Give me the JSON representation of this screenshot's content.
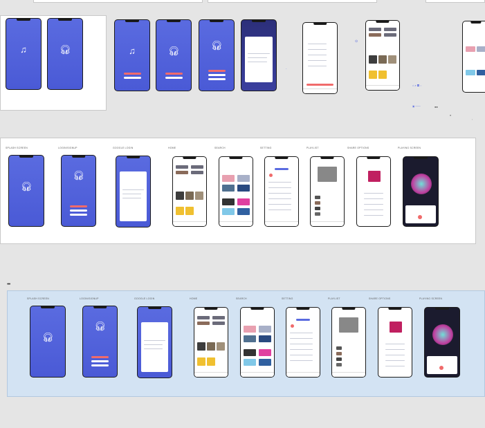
{
  "canvas": {
    "row2_labels": [
      "SPLASH SCREEN",
      "LOGIN/SIGNUP",
      "GOOGLE LOGIN",
      "HOME",
      "SEARCH",
      "SETTING",
      "PLAYLIST",
      "SHARE OPTIONS",
      "PLAYING SCREEN"
    ],
    "row3_labels": [
      "SPLASH SCREEN",
      "LOGIN/SIGNUP",
      "GOOGLE LOGIN",
      "HOME",
      "SEARCH",
      "SETTING",
      "PLAYLIST",
      "SHARE OPTIONS",
      "PLAYING SCREEN"
    ],
    "more_glyph": "•••"
  },
  "colors": {
    "brand": "#5a6be0",
    "accent_red": "#f06b6b",
    "canvas_bg": "#e5e5e5",
    "blue_frame": "#d3e3f3"
  },
  "icons": {
    "splash": "headphones-icon",
    "search": "search-icon",
    "more": "more-horizontal-icon"
  }
}
